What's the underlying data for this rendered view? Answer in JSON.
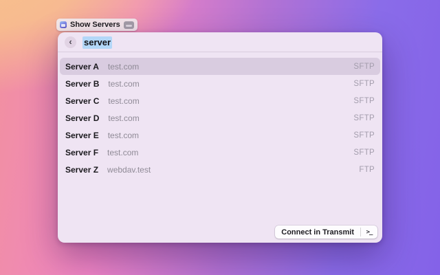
{
  "launcher_pill": {
    "label": "Show Servers",
    "app_icon": "transmit-app-icon",
    "badge_icon": "keycap-icon"
  },
  "search": {
    "value": "server",
    "back_glyph": "‹",
    "selection_color": "#b3d7f8"
  },
  "servers": {
    "rows": [
      {
        "name": "Server A",
        "host": "test.com",
        "protocol": "SFTP",
        "selected": true
      },
      {
        "name": "Server B",
        "host": "test.com",
        "protocol": "SFTP",
        "selected": false
      },
      {
        "name": "Server C",
        "host": "test.com",
        "protocol": "SFTP",
        "selected": false
      },
      {
        "name": "Server D",
        "host": "test.com",
        "protocol": "SFTP",
        "selected": false
      },
      {
        "name": "Server E",
        "host": "test.com",
        "protocol": "SFTP",
        "selected": false
      },
      {
        "name": "Server F",
        "host": "test.com",
        "protocol": "SFTP",
        "selected": false
      },
      {
        "name": "Server Z",
        "host": "webdav.test",
        "protocol": "FTP",
        "selected": false
      }
    ]
  },
  "footer": {
    "connect_label": "Connect in Transmit",
    "terminal_glyph": ">_"
  },
  "colors": {
    "gradient_top_left": "#f6bd8b",
    "gradient_bottom_left": "#ee86c4",
    "gradient_right": "#8462e8",
    "panel_background": "#efe4f3",
    "selected_row": "#d9cce0",
    "text_selection": "#b3d7f8"
  }
}
